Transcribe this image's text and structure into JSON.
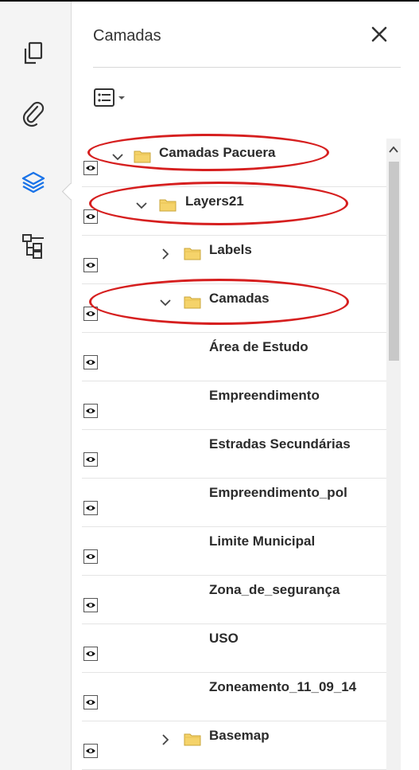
{
  "panel": {
    "title": "Camadas",
    "close_icon": "close-icon",
    "options_icon": "layer-options-icon"
  },
  "rail": {
    "icons": [
      "pages-icon",
      "attachments-icon",
      "layers-icon",
      "model-tree-icon"
    ],
    "active": "layers-icon",
    "accent": "#1a73e8"
  },
  "layers": [
    {
      "label": "Camadas Pacuera",
      "level": 0,
      "toggle": "expanded",
      "folder": true
    },
    {
      "label": "Layers21",
      "level": 1,
      "toggle": "expanded",
      "folder": true
    },
    {
      "label": "Labels",
      "level": 2,
      "toggle": "collapsed",
      "folder": true
    },
    {
      "label": "Camadas",
      "level": 2,
      "toggle": "expanded",
      "folder": true
    },
    {
      "label": "Área de Estudo",
      "level": 3,
      "toggle": "none",
      "folder": false
    },
    {
      "label": "Empreendimento",
      "level": 3,
      "toggle": "none",
      "folder": false
    },
    {
      "label": "Estradas Secundárias",
      "level": 3,
      "toggle": "none",
      "folder": false
    },
    {
      "label": "Empreendimento_pol",
      "level": 3,
      "toggle": "none",
      "folder": false
    },
    {
      "label": "Limite Municipal",
      "level": 3,
      "toggle": "none",
      "folder": false
    },
    {
      "label": "Zona_de_segurança",
      "level": 3,
      "toggle": "none",
      "folder": false
    },
    {
      "label": "USO",
      "level": 3,
      "toggle": "none",
      "folder": false
    },
    {
      "label": "Zoneamento_11_09_14",
      "level": 3,
      "toggle": "none",
      "folder": false
    },
    {
      "label": "Basemap",
      "level": 2,
      "toggle": "collapsed",
      "folder": true
    }
  ],
  "highlight_color": "#d61f1f",
  "folder_color": "#f5d36a"
}
